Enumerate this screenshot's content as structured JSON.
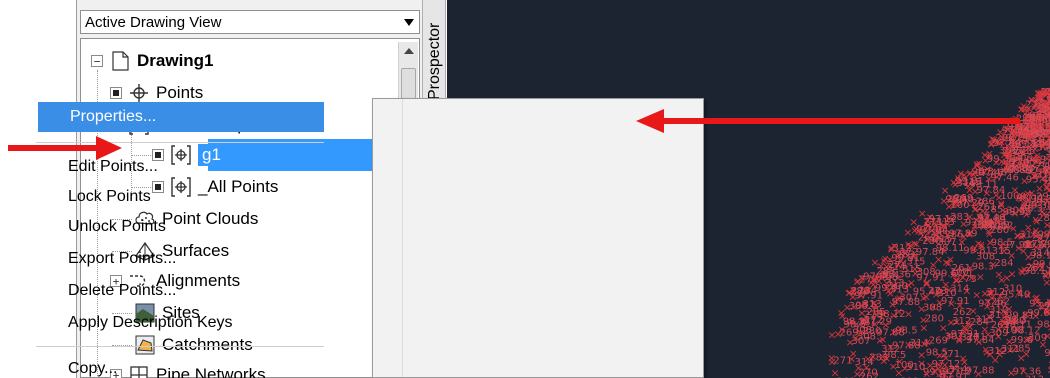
{
  "toolspace": {
    "view_select": "Active Drawing View",
    "tab_label": "Prospector"
  },
  "tree": {
    "root": "Drawing1",
    "items": [
      {
        "label": "Points",
        "icon": "points-icon",
        "expander": "dot"
      },
      {
        "label": "Point Groups",
        "icon": "point-groups-icon",
        "expander": "minus"
      },
      {
        "label": "g1",
        "icon": "point-group-icon",
        "expander": "dot",
        "selected": true
      },
      {
        "label": "_All Points",
        "icon": "point-group-icon",
        "expander": "dot"
      },
      {
        "label": "Point Clouds",
        "icon": "point-clouds-icon",
        "expander": "none"
      },
      {
        "label": "Surfaces",
        "icon": "surfaces-icon",
        "expander": "none"
      },
      {
        "label": "Alignments",
        "icon": "alignments-icon",
        "expander": "plus"
      },
      {
        "label": "Sites",
        "icon": "sites-icon",
        "expander": "none"
      },
      {
        "label": "Catchments",
        "icon": "catchments-icon",
        "expander": "none"
      },
      {
        "label": "Pipe Networks",
        "icon": "pipe-networks-icon",
        "expander": "plus"
      }
    ]
  },
  "context_menu": {
    "items": [
      {
        "label": "Properties...",
        "highlighted": true
      },
      {
        "label": "Edit Points..."
      },
      {
        "label": "Lock Points"
      },
      {
        "label": "Unlock Points"
      },
      {
        "label": "Export Points..."
      },
      {
        "label": "Delete Points..."
      },
      {
        "label": "Apply Description Keys"
      },
      {
        "label": "Copy..."
      }
    ]
  },
  "canvas_labels": [
    "280",
    "100",
    "261",
    "99.6",
    "315",
    "262",
    "95.40",
    "283",
    "314",
    "98.12",
    "284",
    "313",
    "97.84",
    "285",
    "312",
    "97.88",
    "286",
    "311",
    "97.46",
    "310",
    "97.29",
    "309",
    "308",
    "307",
    "306",
    "99.81",
    "98.5",
    "98.3",
    "98.11",
    "97.91",
    "97.89",
    "97.36",
    "97.12",
    "274",
    "273",
    "272",
    "271",
    "270",
    "269",
    "99.38"
  ],
  "colors": {
    "selection": "#3399ff",
    "menu_highlight": "#3a8ee6",
    "canvas_bg": "#1c2331",
    "point_marker": "#d8363c",
    "point_label": "#d94a55",
    "annotation_arrow": "#e81818"
  }
}
